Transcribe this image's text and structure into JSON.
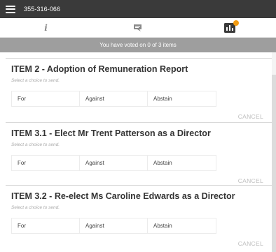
{
  "header": {
    "meeting_id": "355-316-066"
  },
  "tabs": [
    {
      "name": "info",
      "icon": "info-icon"
    },
    {
      "name": "chat",
      "icon": "chat-icon"
    },
    {
      "name": "vote",
      "icon": "vote-icon",
      "badge_color": "#f39c12"
    }
  ],
  "status": {
    "text": "You have voted on 0 of 3 items"
  },
  "hint_text": "Select a choice to send.",
  "cancel_label": "CANCEL",
  "items": [
    {
      "title": "ITEM 2 - Adoption of Remuneration Report",
      "choices": [
        "For",
        "Against",
        "Abstain"
      ]
    },
    {
      "title": "ITEM 3.1 - Elect Mr Trent Patterson as a Director",
      "choices": [
        "For",
        "Against",
        "Abstain"
      ]
    },
    {
      "title": "ITEM 3.2 - Re-elect Ms Caroline Edwards as a Director",
      "choices": [
        "For",
        "Against",
        "Abstain"
      ]
    }
  ]
}
